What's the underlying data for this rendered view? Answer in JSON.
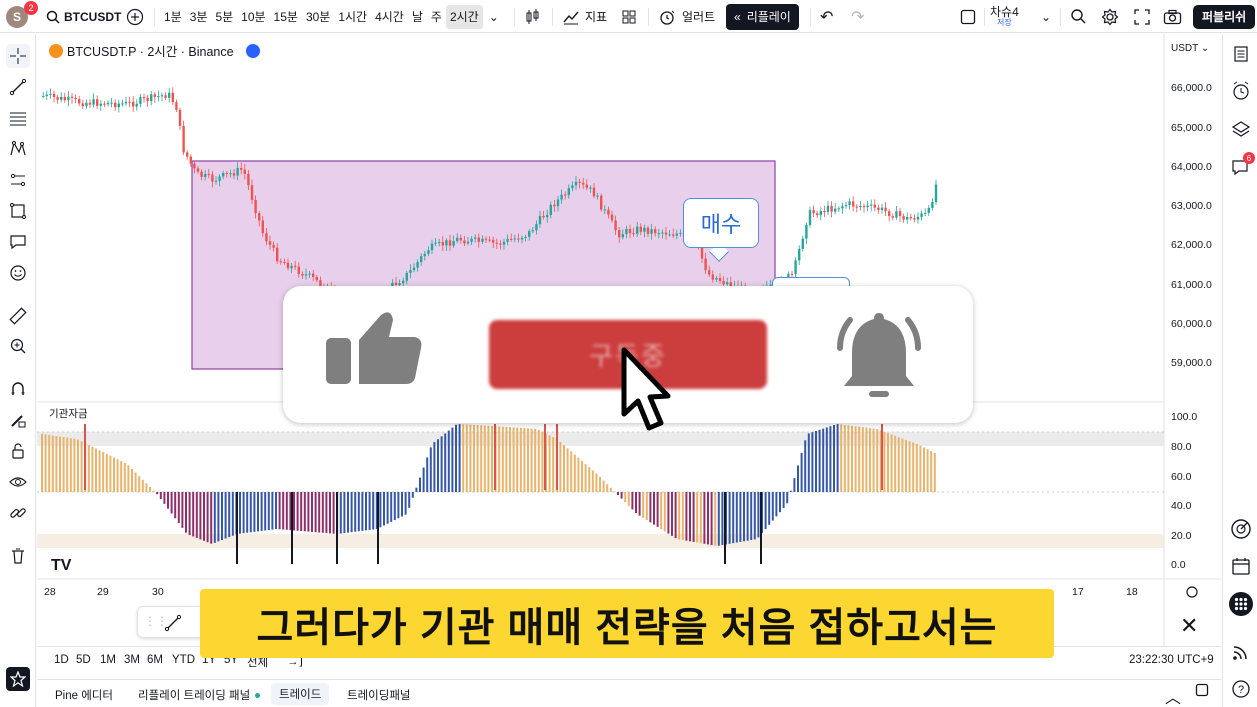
{
  "topbar": {
    "avatar_letter": "S",
    "avatar_badge": "2",
    "symbol": "BTCUSDT",
    "intervals": [
      "1분",
      "3분",
      "5분",
      "10분",
      "15분",
      "30분",
      "1시간",
      "4시간",
      "날",
      "주",
      "2시간"
    ],
    "active_interval": "2시간",
    "indicators_label": "지표",
    "alert_label": "얼러트",
    "replay_label": "리플레이",
    "layout_name": "차슈4",
    "layout_sub": "저장",
    "publish_label": "퍼블리쉬"
  },
  "legend": {
    "title": "BTCUSDT.P · 2시간 · Binance"
  },
  "price_axis": {
    "currency": "USDT",
    "labels": [
      "66,000.0",
      "65,000.0",
      "64,000.0",
      "63,000.0",
      "62,000.0",
      "61,000.0",
      "60,000.0",
      "59,000.0"
    ]
  },
  "indicator": {
    "title": "기관자금",
    "axis_labels": [
      "100.0",
      "80.0",
      "60.0",
      "40.0",
      "20.0",
      "0.0"
    ]
  },
  "time_axis": {
    "labels": [
      "28",
      "29",
      "30",
      "17",
      "18"
    ]
  },
  "callout": {
    "text": "매수"
  },
  "overlay": {
    "subscribe_text": "구독중"
  },
  "range_bar": {
    "items": [
      "1D",
      "5D",
      "1M",
      "3M",
      "6M",
      "YTD",
      "1Y",
      "5Y",
      "전체"
    ],
    "clock": "23:22:30 UTC+9"
  },
  "bottom_panel": {
    "tabs": [
      "Pine 에디터",
      "리플레이 트레이딩 패널",
      "트레이드",
      "트레이딩패널"
    ]
  },
  "caption": {
    "text": "그러다가 기관 매매 전략을 처음 접하고서는"
  },
  "right_badges": {
    "chat_badge": "6"
  },
  "colors": {
    "up": "#26a69a",
    "down": "#ef5350",
    "highlight_box": "#e8d0ec",
    "caption_bg": "#fcd731",
    "subscribe_bg": "#cc3d3d"
  },
  "chart_data": {
    "type": "candlestick",
    "title": "BTCUSDT.P · 2시간 · Binance",
    "ylim": [
      58500,
      66600
    ],
    "indicator_ylim": [
      0,
      100
    ]
  }
}
